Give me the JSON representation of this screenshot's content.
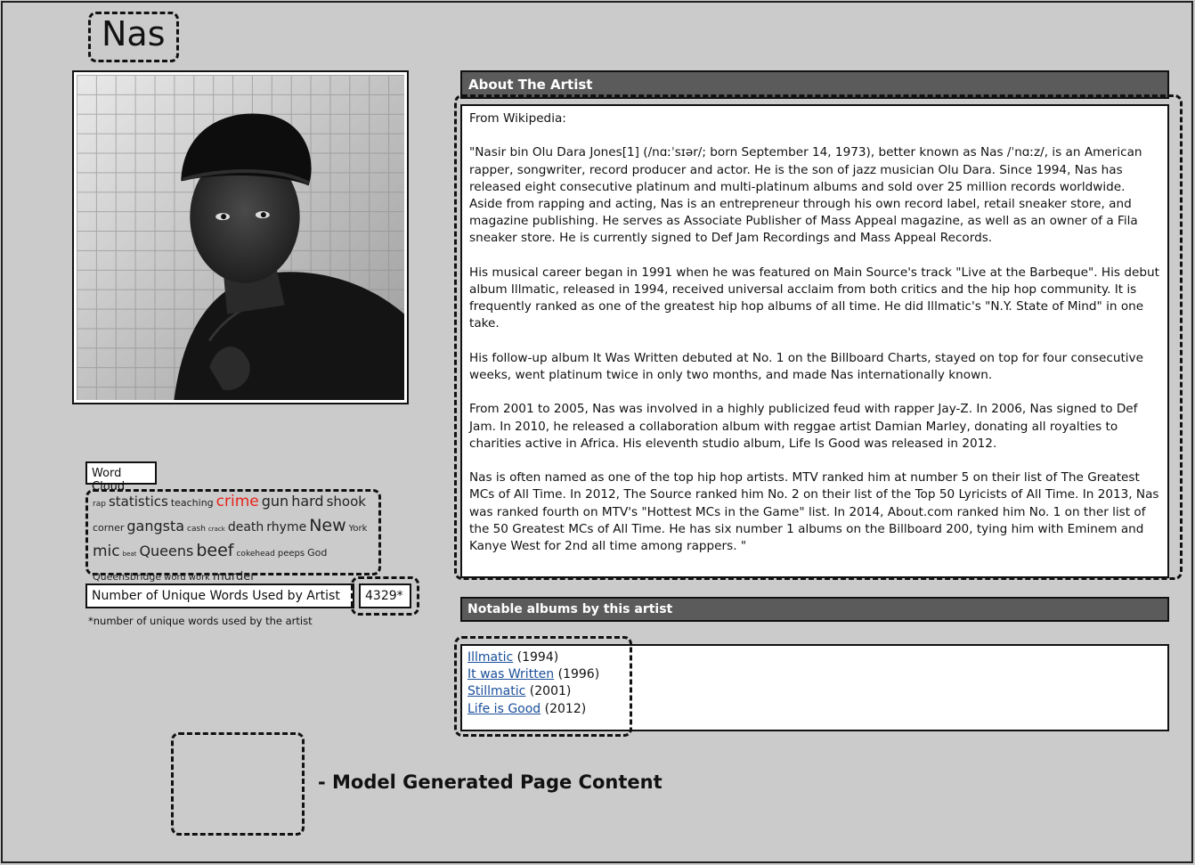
{
  "title": "Nas",
  "word_cloud": {
    "label": "Word Cloud",
    "words": [
      {
        "text": "rap",
        "size": 9,
        "highlight": false
      },
      {
        "text": "statistics",
        "size": 15,
        "highlight": false
      },
      {
        "text": "teaching",
        "size": 11,
        "highlight": false
      },
      {
        "text": "crime",
        "size": 17,
        "highlight": true
      },
      {
        "text": "gun",
        "size": 16,
        "highlight": false
      },
      {
        "text": "hard",
        "size": 16,
        "highlight": false
      },
      {
        "text": "shook",
        "size": 15,
        "highlight": false
      },
      {
        "text": "corner",
        "size": 11,
        "highlight": false
      },
      {
        "text": "gangsta",
        "size": 16,
        "highlight": false
      },
      {
        "text": "cash",
        "size": 9,
        "highlight": false
      },
      {
        "text": "crack",
        "size": 7,
        "highlight": false
      },
      {
        "text": "death",
        "size": 14,
        "highlight": false
      },
      {
        "text": "rhyme",
        "size": 14,
        "highlight": false
      },
      {
        "text": "New",
        "size": 19,
        "highlight": false
      },
      {
        "text": "York",
        "size": 10,
        "highlight": false
      },
      {
        "text": "mic",
        "size": 17,
        "highlight": false
      },
      {
        "text": "beat",
        "size": 7,
        "highlight": false
      },
      {
        "text": "Queens",
        "size": 16,
        "highlight": false
      },
      {
        "text": "beef",
        "size": 19,
        "highlight": false
      },
      {
        "text": "cokehead",
        "size": 9,
        "highlight": false
      },
      {
        "text": "peeps",
        "size": 10,
        "highlight": false
      },
      {
        "text": "God",
        "size": 11,
        "highlight": false
      },
      {
        "text": "Queensbridge",
        "size": 11,
        "highlight": false
      },
      {
        "text": "word",
        "size": 10,
        "highlight": false
      },
      {
        "text": "work",
        "size": 10,
        "highlight": false
      },
      {
        "text": "murder",
        "size": 13,
        "highlight": false
      }
    ],
    "highlight_color": "#e8231c"
  },
  "unique_words": {
    "label": "Number of Unique Words Used by Artist",
    "value": "4329*",
    "note": "*number of unique words used by the artist"
  },
  "about": {
    "header": "About The Artist",
    "paragraphs": [
      "From Wikipedia:",
      "\"Nasir bin Olu Dara Jones[1] (/nɑːˈsɪər/; born September 14, 1973), better known as Nas /ˈnɑːz/, is an American rapper, songwriter, record producer and actor. He is the son of jazz musician Olu Dara. Since 1994, Nas has released eight consecutive platinum and multi-platinum albums and sold over 25 million records worldwide. Aside from rapping and acting, Nas is an entrepreneur through his own record label, retail sneaker store, and magazine publishing. He serves as Associate Publisher of Mass Appeal magazine, as well as an owner of a Fila sneaker store. He is currently signed to Def Jam Recordings and Mass Appeal Records.",
      "His musical career began in 1991 when he was featured on Main Source's track \"Live at the Barbeque\". His debut album Illmatic, released in 1994, received universal acclaim from both critics and the hip hop community. It is frequently ranked as one of the greatest hip hop albums of all time. He did Illmatic's \"N.Y. State of Mind\" in one take.",
      "His follow-up album It Was Written debuted at No. 1 on the Billboard Charts, stayed on top for four consecutive weeks, went platinum twice in only two months, and made Nas internationally known.",
      "From 2001 to 2005, Nas was involved in a highly publicized feud with rapper Jay-Z. In 2006, Nas signed to Def Jam. In 2010, he released a collaboration album with reggae artist Damian Marley, donating all royalties to charities active in Africa. His eleventh studio album, Life Is Good was released in 2012.",
      "Nas is often named as one of the top hip hop artists. MTV ranked him at number 5 on their list of The Greatest MCs of All Time. In 2012, The Source ranked him No. 2 on their list of the Top 50 Lyricists of All Time. In 2013, Nas was ranked fourth on MTV's \"Hottest MCs in the Game\" list. In 2014, About.com ranked him No. 1 on ther list of the 50 Greatest MCs of All Time. He has six number 1 albums on the Billboard 200, tying him with Eminem and Kanye West for 2nd all time among rappers. \""
    ]
  },
  "albums": {
    "header": "Notable albums by this artist",
    "items": [
      {
        "title": "Illmatic",
        "year": "(1994)"
      },
      {
        "title": "It was Written",
        "year": "(1996)"
      },
      {
        "title": "Stillmatic",
        "year": "(2001)"
      },
      {
        "title": "Life is Good",
        "year": "(2012)"
      }
    ]
  },
  "legend": {
    "text": "- Model Generated Page Content"
  },
  "colors": {
    "background": "#cbcbcb",
    "header_bar": "#5b5b5b",
    "link": "#1a4f9a"
  }
}
